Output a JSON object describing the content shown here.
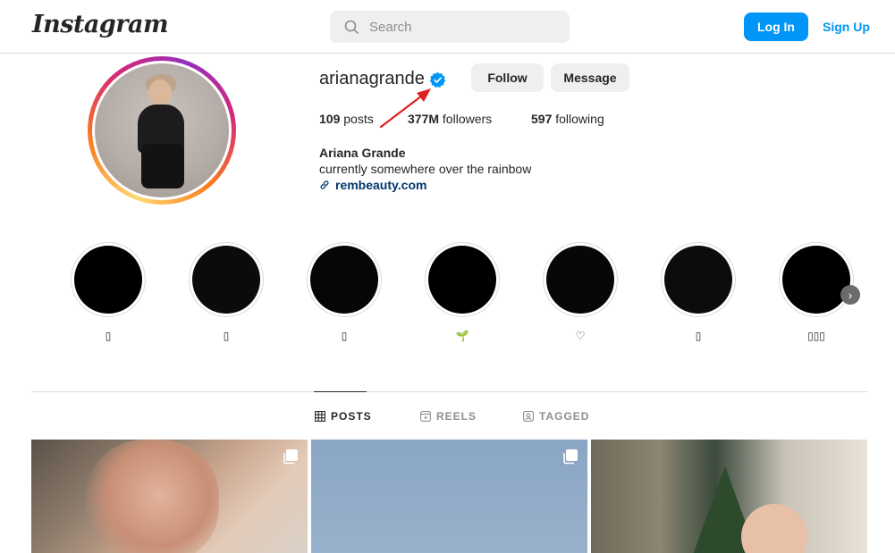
{
  "header": {
    "logo_text": "Instagram",
    "search_placeholder": "Search",
    "login_label": "Log In",
    "signup_label": "Sign Up"
  },
  "profile": {
    "username": "arianagrande",
    "follow_label": "Follow",
    "message_label": "Message",
    "stats": {
      "posts_count": "109",
      "posts_label": "posts",
      "followers_count": "377M",
      "followers_label": "followers",
      "following_count": "597",
      "following_label": "following"
    },
    "full_name": "Ariana Grande",
    "bio": "currently somewhere over the rainbow",
    "link": "rembeauty.com"
  },
  "highlights": [
    {
      "label": "▯"
    },
    {
      "label": "▯"
    },
    {
      "label": "▯"
    },
    {
      "label": "🌱"
    },
    {
      "label": "♡"
    },
    {
      "label": "▯"
    },
    {
      "label": "▯▯▯"
    }
  ],
  "tabs": {
    "posts": "POSTS",
    "reels": "REELS",
    "tagged": "TAGGED"
  },
  "colors": {
    "accent": "#0095f6",
    "link": "#00376b",
    "annotation_arrow": "#e02020"
  }
}
